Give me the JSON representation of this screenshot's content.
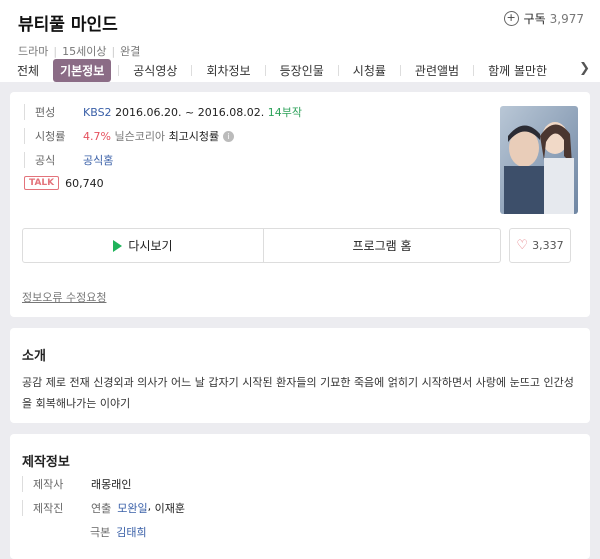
{
  "header": {
    "title": "뷰티풀 마인드",
    "genre": "드라마",
    "rating": "15세이상",
    "status": "완결",
    "subscribe_label": "구독",
    "subscribe_count": "3,977",
    "subscribe_icon": "plus-circle-icon"
  },
  "tabs": [
    {
      "label": "전체"
    },
    {
      "label": "기본정보",
      "active": true
    },
    {
      "label": "공식영상"
    },
    {
      "label": "회차정보"
    },
    {
      "label": "등장인물"
    },
    {
      "label": "시청률"
    },
    {
      "label": "관련앨범"
    },
    {
      "label": "함께 볼만한"
    }
  ],
  "tabs_more_icon": "chevron-right-icon",
  "info": {
    "broadcast_label": "편성",
    "channel": "KBS2",
    "period": "2016.06.20. ~ 2016.08.02.",
    "episodes": "14부작",
    "ratings_label": "시청률",
    "rating_value": "4.7%",
    "rating_source": "닐슨코리아",
    "rating_best": "최고시청률",
    "official_label": "공식",
    "official_link": "공식홈",
    "talk_badge": "TALK",
    "talk_count": "60,740"
  },
  "buttons": {
    "replay": "다시보기",
    "program_home": "프로그램 홈",
    "like_count": "3,337"
  },
  "report_link": "정보오류 수정요청",
  "intro": {
    "title": "소개",
    "text": "공감 제로 전재 신경외과 의사가 어느 날 갑자기 시작된 환자들의 기묘한 죽음에 얽히기 시작하면서 사랑에 눈뜨고 인간성을 회복해나가는 이야기"
  },
  "production": {
    "title": "제작정보",
    "company_label": "제작사",
    "company": "래몽래인",
    "staff_label": "제작진",
    "director_role": "연출",
    "director1": "모완일",
    "director2": "이재훈",
    "writer_role": "극본",
    "writer": "김태희"
  },
  "colors": {
    "active_tab": "#8b6c86",
    "link_blue": "#3a60a8",
    "green": "#2ea25a",
    "red": "#e5505d",
    "background": "#ececf0"
  }
}
